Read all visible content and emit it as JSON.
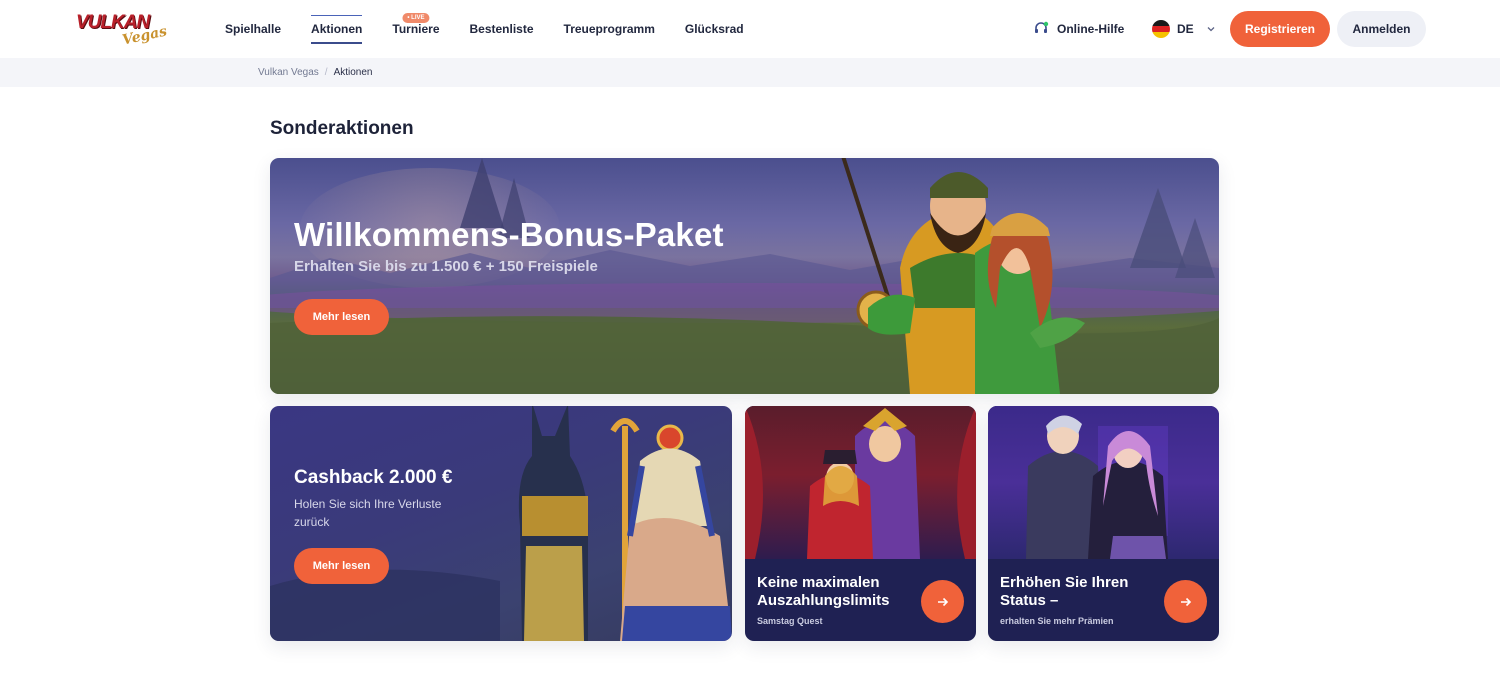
{
  "brand": {
    "logo_word": "VULKAN",
    "logo_script": "Vegas"
  },
  "nav": {
    "items": [
      {
        "label": "Spielhalle"
      },
      {
        "label": "Aktionen"
      },
      {
        "label": "Turniere",
        "badge": "• LIVE"
      },
      {
        "label": "Bestenliste"
      },
      {
        "label": "Treueprogramm"
      },
      {
        "label": "Glücksrad"
      }
    ]
  },
  "header": {
    "help_label": "Online-Hilfe",
    "language": "DE",
    "register_label": "Registrieren",
    "login_label": "Anmelden"
  },
  "breadcrumb": {
    "home": "Vulkan Vegas",
    "separator": "/",
    "current": "Aktionen"
  },
  "section": {
    "title": "Sonderaktionen"
  },
  "hero": {
    "title": "Willkommens-Bonus-Paket",
    "subtitle": "Erhalten Sie bis zu 1.500 € + 150 Freispiele",
    "button_label": "Mehr lesen"
  },
  "cashback": {
    "title": "Cashback 2.000 €",
    "subtitle": "Holen Sie sich Ihre Verluste zurück",
    "button_label": "Mehr lesen"
  },
  "cards": [
    {
      "title": "Keine maximalen Auszahlungslimits",
      "subtitle": "Samstag Quest"
    },
    {
      "title": "Erhöhen Sie Ihren Status –",
      "subtitle": "erhalten Sie mehr Prämien"
    }
  ],
  "colors": {
    "accent": "#f0623a",
    "card_dark": "#1f2153",
    "nav_active": "#3b4c8c",
    "crumb_bg": "#f4f5f9"
  },
  "icons": {
    "help": "headset-icon",
    "language": "germany-flag-icon",
    "dropdown": "chevron-down-icon",
    "card_action": "arrow-right-icon"
  }
}
